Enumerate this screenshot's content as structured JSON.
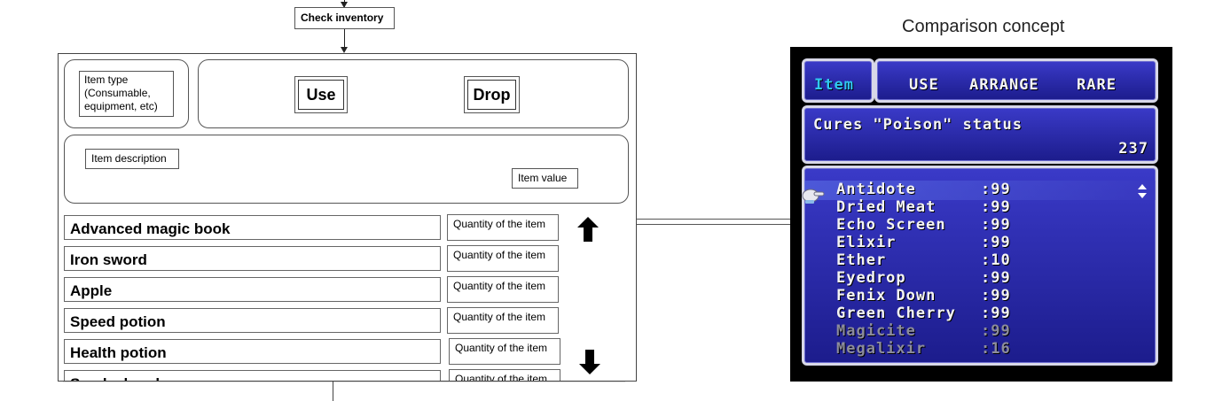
{
  "flow": {
    "check_inventory": "Check inventory"
  },
  "wireframe": {
    "item_type": "Item type (Consumable, equipment, etc)",
    "use_button": "Use",
    "drop_button": "Drop",
    "item_description": "Item description",
    "item_value": "Item value",
    "items": [
      {
        "name": "Advanced magic book",
        "qty": "Quantity of the item"
      },
      {
        "name": "Iron sword",
        "qty": "Quantity of the item"
      },
      {
        "name": "Apple",
        "qty": "Quantity of the item"
      },
      {
        "name": "Speed potion",
        "qty": "Quantity of the item"
      },
      {
        "name": "Health potion",
        "qty": "Quantity of the item"
      },
      {
        "name": "Smoke bomb",
        "qty": "Quantity of the item"
      }
    ],
    "scroll_up_icon": "arrow-up-icon",
    "scroll_down_icon": "arrow-down-icon"
  },
  "concept": {
    "heading": "Comparison concept",
    "tabs": {
      "item": "Item",
      "use": "USE",
      "arrange": "ARRANGE",
      "rare": "RARE"
    },
    "description": "Cures \"Poison\" status",
    "gil": "237",
    "items": [
      {
        "name": "Antidote",
        "qty": ":99",
        "dim": false
      },
      {
        "name": "Dried Meat",
        "qty": ":99",
        "dim": false
      },
      {
        "name": "Echo Screen",
        "qty": ":99",
        "dim": false
      },
      {
        "name": "Elixir",
        "qty": ":99",
        "dim": false
      },
      {
        "name": "Ether",
        "qty": ":10",
        "dim": false
      },
      {
        "name": "Eyedrop",
        "qty": ":99",
        "dim": false
      },
      {
        "name": "Fenix Down",
        "qty": ":99",
        "dim": false
      },
      {
        "name": "Green Cherry",
        "qty": ":99",
        "dim": false
      },
      {
        "name": "Magicite",
        "qty": ":99",
        "dim": true
      },
      {
        "name": "Megalixir",
        "qty": ":16",
        "dim": true
      }
    ],
    "colors": {
      "item_tab": "#30c8f0",
      "panel_top": "#3a3ac8",
      "panel_bottom": "#1c1c8c",
      "text": "#f4f4f4",
      "dim_text": "#8c8c9c"
    },
    "cursor_icon": "pointing-hand-icon",
    "scroll_icon": "up-down-arrows-icon"
  }
}
